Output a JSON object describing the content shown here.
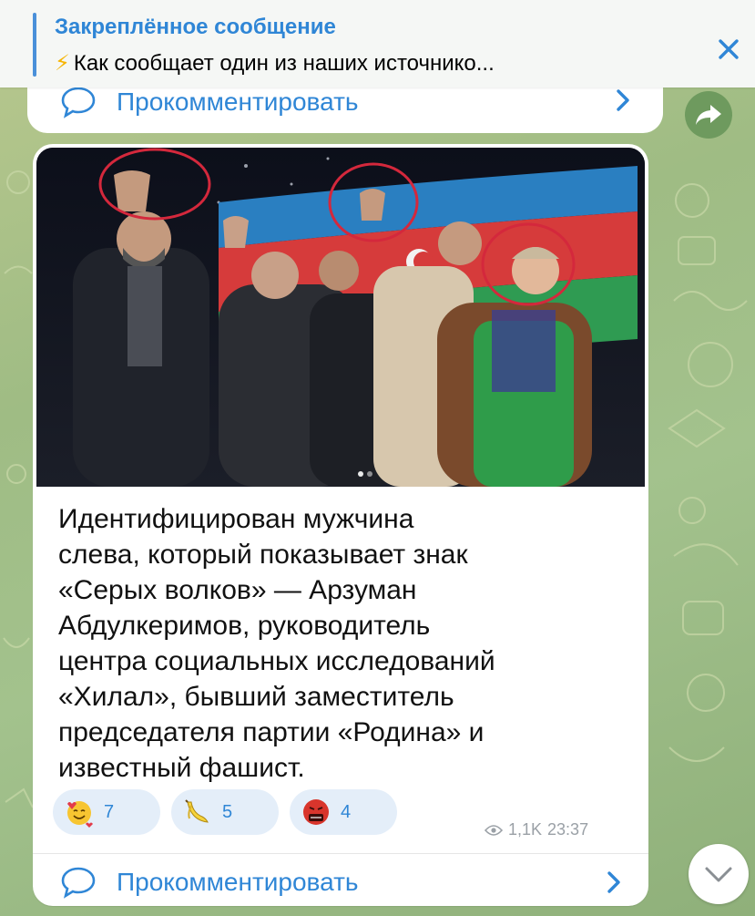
{
  "pinned": {
    "title": "Закреплённое сообщение",
    "text": "Как сообщает один из наших источнико..."
  },
  "comment_top": {
    "label": "Прокомментировать"
  },
  "message": {
    "text": "Идентифицирован мужчина\nслева, который показывает знак\n«Серых волков» — Арзуман\nАбдулкеримов, руководитель\nцентра социальных исследований\n«Хилал», бывший заместитель\nпредседателя партии «Родина» и\nизвестный фашист.",
    "reactions": [
      {
        "emoji": "smiling-face-with-hearts-icon",
        "count": "7"
      },
      {
        "emoji": "banana-icon",
        "count": "5"
      },
      {
        "emoji": "face-with-symbols-on-mouth-icon",
        "count": "4"
      }
    ],
    "views": "1,1K",
    "time": "23:37"
  },
  "comment_bottom": {
    "label": "Прокомментировать"
  },
  "colors": {
    "accent": "#2f86d6",
    "reaction_bg": "#e4eef9",
    "chat_bg": "#a3c28d"
  }
}
